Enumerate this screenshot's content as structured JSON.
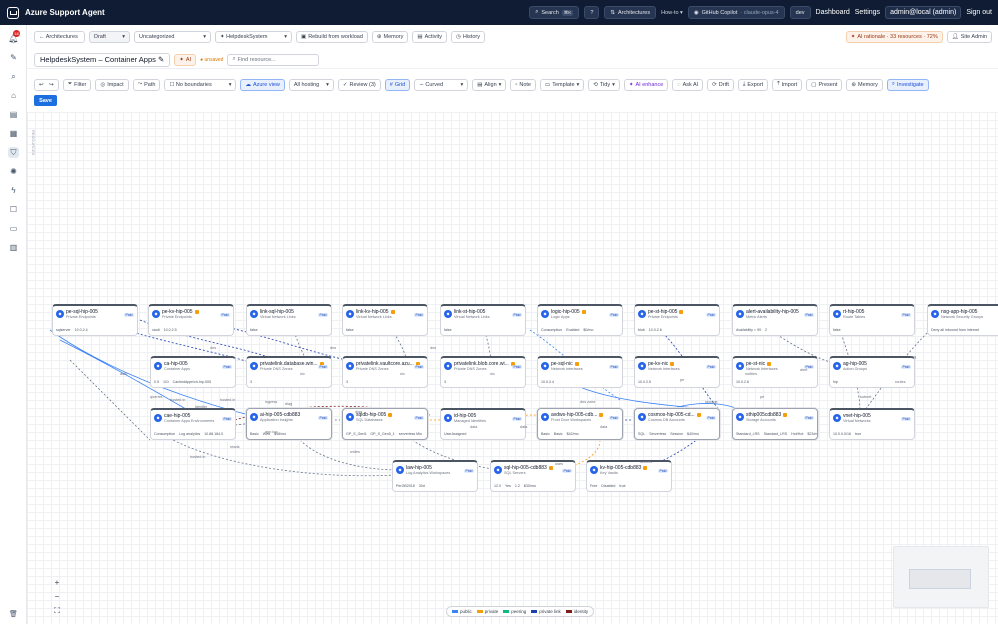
{
  "topbar": {
    "title": "Azure Support Agent",
    "search": "Search",
    "search_kbd": "⌘K",
    "help": "?",
    "arch": "Architectures",
    "howto": "How-to",
    "copilot": "GitHub Copilot",
    "copilot_model": "claude-opus-4",
    "env": "dev",
    "dashboard": "Dashboard",
    "settings": "Settings",
    "user": "admin@local (admin)",
    "signout": "Sign out"
  },
  "sidebar": {
    "badge": "18"
  },
  "toolbar1": {
    "back": "← Architectures",
    "status": "Draft",
    "category": "Uncategorized",
    "system": "HelpdeskSystem",
    "rebuild": "Rebuild from workload",
    "memory": "Memory",
    "activity": "Activity",
    "history": "History",
    "ai_rationale": "AI rationale · 33 resources · 72%",
    "site_admin": "Site Admin"
  },
  "toolbar2": {
    "project": "HelpdeskSystem – Container Apps",
    "ai": "AI",
    "unsaved": "unsaved",
    "find_placeholder": "Find resource..."
  },
  "toolbar3": {
    "undo": "↩",
    "redo": "↪",
    "filter": "Filter",
    "impact": "Impact",
    "path": "Path",
    "boundaries": "No boundaries",
    "azure_view": "Azure view",
    "hosting": "All hosting",
    "review": "Review (3)",
    "grid": "Grid",
    "curved": "Curved",
    "align": "Align",
    "note": "Note",
    "template": "Template",
    "tidy": "Tidy",
    "ai_enhance": "AI enhance",
    "ask_ai": "Ask AI",
    "drift": "Drift",
    "export": "Export",
    "import": "Import",
    "present": "Present",
    "memory": "Memory",
    "investigate": "Investigate"
  },
  "save": "Save",
  "canvas": {
    "side_label": "RESOURCES"
  },
  "nodes": [
    {
      "name": "pe-sql-hip-005",
      "type": "Private Endpoints",
      "tier": "Pstd",
      "meta": [
        "sqlserver",
        "10.0.2.4"
      ]
    },
    {
      "name": "pe-kv-hip-005",
      "type": "Private Endpoints",
      "tier": "Pstd",
      "meta": [
        "vault",
        "10.0.2.5"
      ]
    },
    {
      "name": "link-sql-hip-005",
      "type": "Virtual Network Links",
      "tier": "Pstd",
      "meta": [
        "false"
      ]
    },
    {
      "name": "link-kv-hip-005",
      "type": "Virtual Network Links",
      "tier": "Pstd",
      "meta": [
        "false"
      ]
    },
    {
      "name": "link-st-hip-005",
      "type": "Virtual Network Links",
      "tier": "Pstd",
      "meta": [
        "false"
      ]
    },
    {
      "name": "logic-hip-005",
      "type": "Logic Apps",
      "tier": "Pstd",
      "meta": [
        "Consumption",
        "Enabled",
        "$0/mo"
      ]
    },
    {
      "name": "pe-st-hip-005",
      "type": "Private Endpoints",
      "tier": "Pstd",
      "meta": [
        "blob",
        "10.0.2.6"
      ]
    },
    {
      "name": "alert-availability-hip-005",
      "type": "Metric Alerts",
      "tier": "Pstd",
      "meta": [
        "Availability < 99",
        "2"
      ]
    },
    {
      "name": "rt-hip-005",
      "type": "Route Tables",
      "tier": "Pstd",
      "meta": [
        "false"
      ]
    },
    {
      "name": "nsg-app-hip-005",
      "type": "Network Security Groups",
      "tier": "Pstd",
      "meta": [
        "Deny all inbound from internet"
      ]
    },
    {
      "name": "ca-hip-005",
      "type": "Container Apps",
      "tier": "Pstd",
      "meta": [
        "0.5",
        "1Gi",
        "Cacheddppe/ch-hip-005"
      ]
    },
    {
      "name": "privatelink.database.win...",
      "type": "Private DNS Zones",
      "tier": "Pstd",
      "meta": [
        "3"
      ]
    },
    {
      "name": "privatelink.vaultcore.azu...",
      "type": "Private DNS Zones",
      "tier": "Pstd",
      "meta": [
        "3"
      ]
    },
    {
      "name": "privatelink.blob.core.wi...",
      "type": "Private DNS Zones",
      "tier": "Pstd",
      "meta": [
        "3"
      ]
    },
    {
      "name": "pe-sql-nic",
      "type": "Network Interfaces",
      "tier": "Pstd",
      "meta": [
        "10.0.2.4"
      ]
    },
    {
      "name": "pe-kv-nic",
      "type": "Network Interfaces",
      "tier": "Pstd",
      "meta": [
        "10.0.2.5"
      ]
    },
    {
      "name": "pe-st-nic",
      "type": "Network Interfaces",
      "tier": "Pstd",
      "meta": [
        "10.0.2.6"
      ]
    },
    {
      "name": "ag-hip-005",
      "type": "Action Groups",
      "tier": "Pstd",
      "meta": [
        "hip"
      ]
    },
    {
      "name": "cae-hip-005",
      "type": "Container Apps Environments",
      "tier": "Pstd",
      "meta": [
        "Consumption",
        "Log analytics",
        "10.88.184.0"
      ]
    },
    {
      "name": "ai-hip-005-cdb883",
      "type": "Application Insights",
      "tier": "Pstd",
      "meta": [
        "Basic",
        "Web",
        "$18/mo"
      ]
    },
    {
      "name": "sqldb-hip-005",
      "type": "SQL Databases",
      "tier": "Pstd",
      "meta": [
        "GP_S_Gen5",
        "GP_S_Gen5_1",
        "serverless Min"
      ]
    },
    {
      "name": "id-hip-005",
      "type": "Managed Identities",
      "tier": "Pstd",
      "meta": [
        "UserAssigned"
      ]
    },
    {
      "name": "avdws-hip-005-cdb...",
      "type": "Front Door Workspaces",
      "tier": "Pstd",
      "meta": [
        "Basic",
        "Basic",
        "$42/mo"
      ]
    },
    {
      "name": "cosmos-hip-005-cd...",
      "type": "Cosmos DB Accounts",
      "tier": "Pstd",
      "meta": [
        "SQL",
        "Serverless",
        "Session",
        "$40/mo"
      ]
    },
    {
      "name": "sthip005cdb883",
      "type": "Storage Accounts",
      "tier": "Pstd",
      "meta": [
        "Standard_LRS",
        "Standard_LRS",
        "Hot/Hot",
        "$23/mo"
      ]
    },
    {
      "name": "vnet-hip-005",
      "type": "Virtual Networks",
      "tier": "Pstd",
      "meta": [
        "10.0.0.0/16",
        "true"
      ]
    },
    {
      "name": "law-hip-005",
      "type": "Log Analytics Workspaces",
      "tier": "Pstd",
      "meta": [
        "PerGB2018",
        "30d"
      ]
    },
    {
      "name": "sql-hip-005-cdb883",
      "type": "SQL Servers",
      "tier": "Pstd",
      "meta": [
        "12.0",
        "Yes",
        "1.2",
        "$30/mo"
      ]
    },
    {
      "name": "kv-hip-005-cdb883",
      "type": "Key Vaults",
      "tier": "Pstd",
      "meta": [
        "Free",
        "Disabled",
        "true"
      ]
    }
  ],
  "edge_labels": [
    "dns",
    "dns",
    "dns",
    "nic",
    "nic",
    "nic",
    "hosted in",
    "hosted in",
    "ingress",
    "identity",
    "diag",
    "diag",
    "data",
    "data",
    "data",
    "secrets",
    "storage",
    "notifies",
    "alert",
    "subnet",
    "routes",
    "nsg",
    "auth",
    "queries",
    "reads",
    "writes",
    "uses",
    "app log",
    "dns zone",
    "hosted in",
    "pe",
    "pe"
  ],
  "legend": [
    {
      "label": "public",
      "color": "#3b82f6"
    },
    {
      "label": "private",
      "color": "#f59e0b"
    },
    {
      "label": "peering",
      "color": "#10b981"
    },
    {
      "label": "private link",
      "color": "#1e40af"
    },
    {
      "label": "identity",
      "color": "#7f1d1d"
    }
  ],
  "colors": {
    "accent": "#1d6fe0",
    "topbar": "#0f1c33"
  }
}
